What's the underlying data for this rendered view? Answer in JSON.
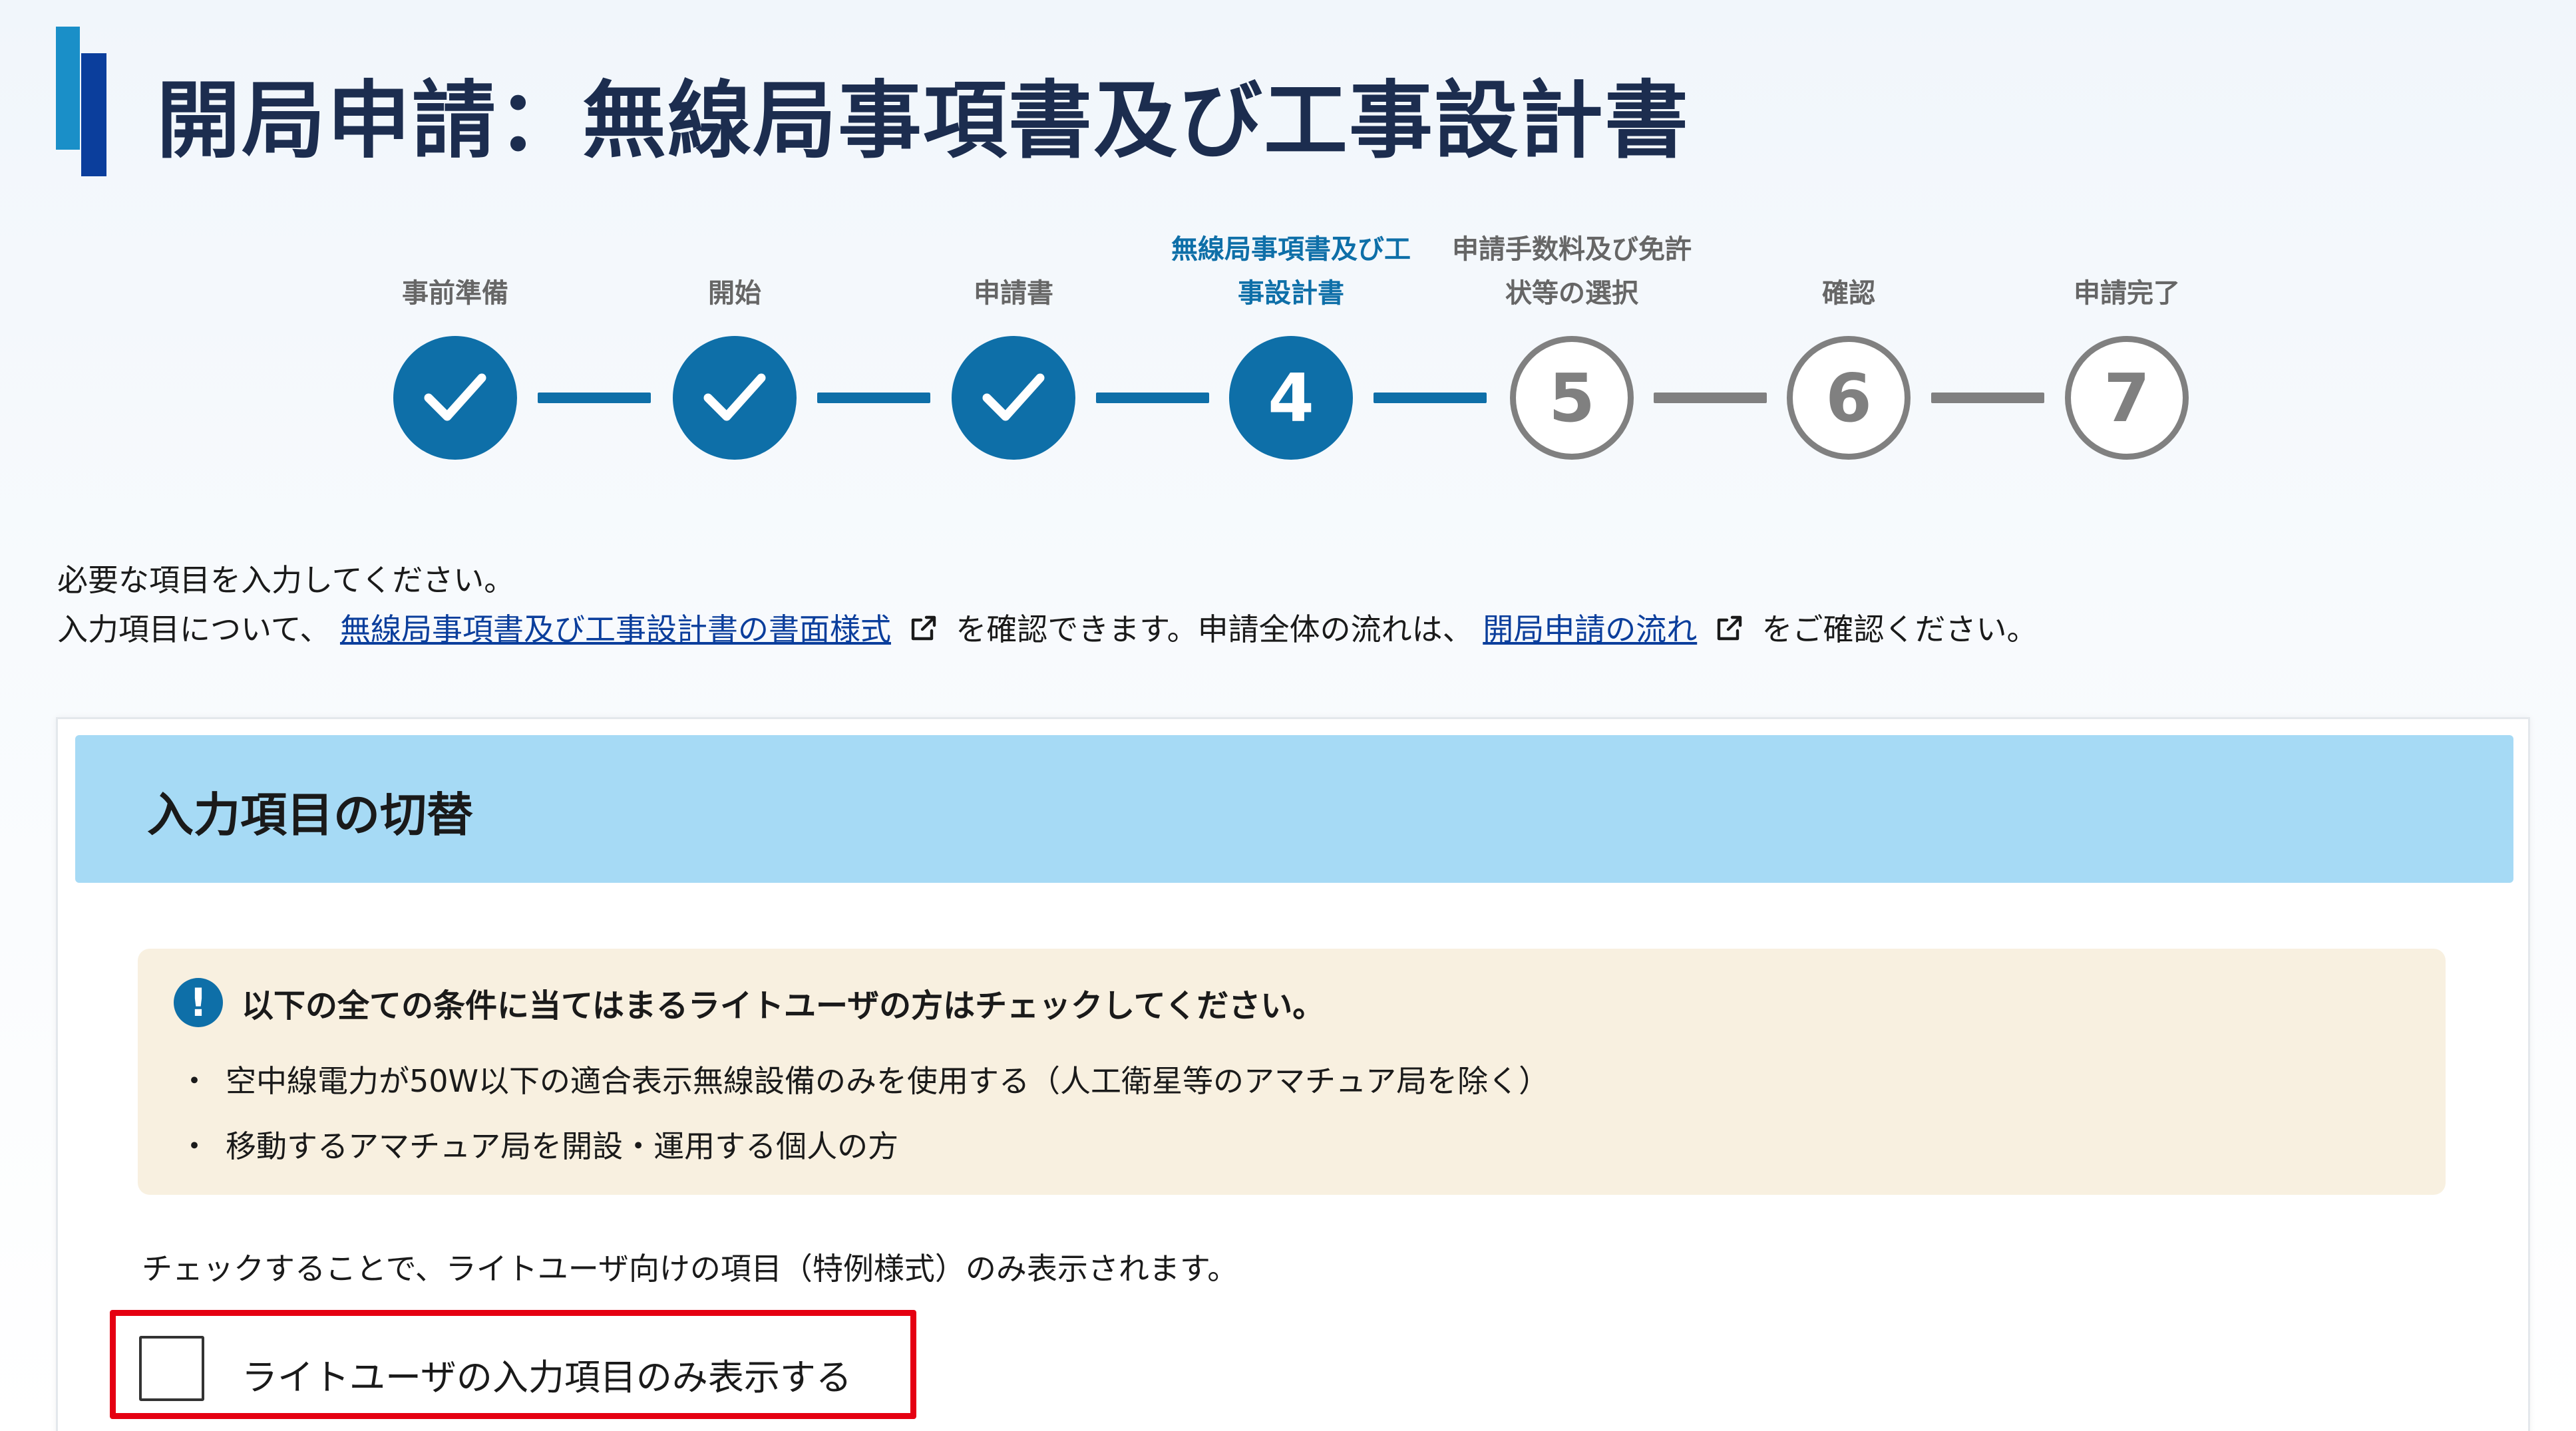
{
  "page": {
    "title": "開局申請：無線局事項書及び工事設計書"
  },
  "stepper": {
    "steps": [
      {
        "number": "1",
        "line1": "",
        "line2": "事前準備",
        "state": "done"
      },
      {
        "number": "2",
        "line1": "",
        "line2": "開始",
        "state": "done"
      },
      {
        "number": "3",
        "line1": "",
        "line2": "申請書",
        "state": "done"
      },
      {
        "number": "4",
        "line1": "無線局事項書及び工",
        "line2": "事設計書",
        "state": "current"
      },
      {
        "number": "5",
        "line1": "申請手数料及び免許",
        "line2": "状等の選択",
        "state": "todo"
      },
      {
        "number": "6",
        "line1": "",
        "line2": "確認",
        "state": "todo"
      },
      {
        "number": "7",
        "line1": "",
        "line2": "申請完了",
        "state": "todo"
      }
    ],
    "colors": {
      "active": "#0e6fa8",
      "inactive": "#808080"
    }
  },
  "intro": {
    "line1": "必要な項目を入力してください。",
    "line2_prefix": "入力項目について、",
    "link1": "無線局事項書及び工事設計書の書面様式",
    "line2_mid": "を確認できます。申請全体の流れは、",
    "link2": "開局申請の流れ",
    "line2_suffix": "をご確認ください。"
  },
  "section": {
    "title": "入力項目の切替",
    "notice": {
      "title": "以下の全ての条件に当てはまるライトユーザの方はチェックしてください。",
      "bullet": "・",
      "items": [
        "空中線電力が50W以下の適合表示無線設備のみを使用する（人工衛星等のアマチュア局を除く）",
        "移動するアマチュア局を開設・運用する個人の方"
      ]
    },
    "helper": "チェックすることで、ライトユーザ向けの項目（特例様式）のみ表示されます。",
    "checkbox": {
      "label": "ライトユーザの入力項目のみ表示する",
      "checked": false
    }
  }
}
